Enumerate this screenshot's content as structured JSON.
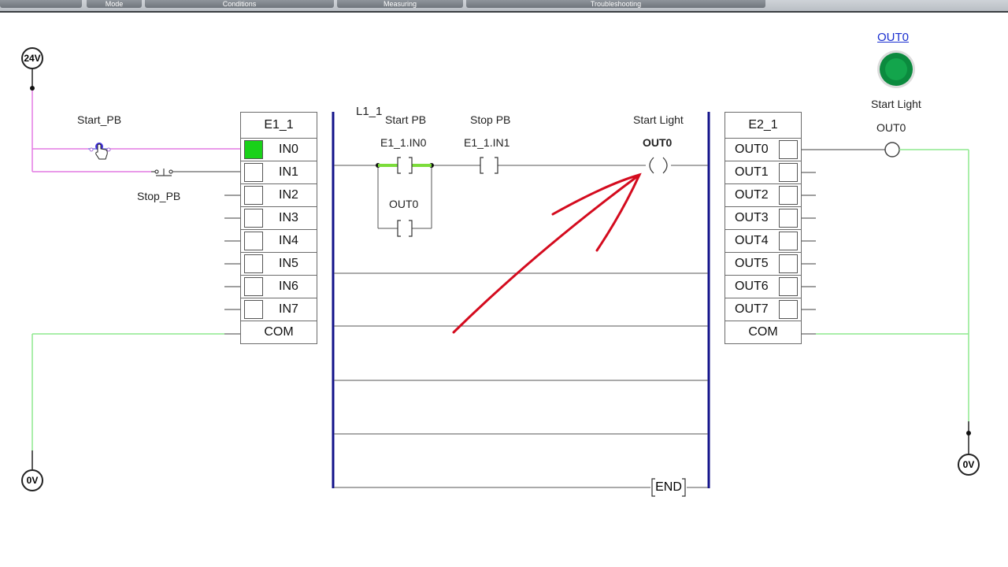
{
  "toolbar": {
    "tabs": [
      "",
      "Mode",
      "Conditions",
      "Measuring",
      "Troubleshooting"
    ]
  },
  "power": {
    "supply_24v": "24V",
    "ground_left": "0V",
    "ground_right": "0V"
  },
  "devices": {
    "start_pb": "Start_PB",
    "stop_pb": "Stop_PB"
  },
  "input_module": {
    "name": "E1_1",
    "channels": [
      {
        "label": "IN0",
        "on": true
      },
      {
        "label": "IN1",
        "on": false
      },
      {
        "label": "IN2",
        "on": false
      },
      {
        "label": "IN3",
        "on": false
      },
      {
        "label": "IN4",
        "on": false
      },
      {
        "label": "IN5",
        "on": false
      },
      {
        "label": "IN6",
        "on": false
      },
      {
        "label": "IN7",
        "on": false
      }
    ],
    "common": "COM"
  },
  "output_module": {
    "name": "E2_1",
    "channels": [
      {
        "label": "OUT0"
      },
      {
        "label": "OUT1"
      },
      {
        "label": "OUT2"
      },
      {
        "label": "OUT3"
      },
      {
        "label": "OUT4"
      },
      {
        "label": "OUT5"
      },
      {
        "label": "OUT6"
      },
      {
        "label": "OUT7"
      }
    ],
    "common": "COM"
  },
  "ladder": {
    "rung_label": "L1_1",
    "contact1_desc": "Start PB",
    "contact1_tag": "E1_1.IN0",
    "contact2_desc": "Stop PB",
    "contact2_tag": "E1_1.IN1",
    "seal_tag": "OUT0",
    "coil_desc": "Start Light",
    "coil_tag": "OUT0",
    "end_label": "END"
  },
  "indicator": {
    "link_label": "OUT0",
    "name": "Start Light",
    "terminal_label": "OUT0",
    "lamp_color": "#0b8a3e"
  },
  "colors": {
    "wire_pink": "#e27ae2",
    "wire_green": "#8ee88e",
    "rail_blue": "#12128a",
    "active_green": "#19d119",
    "annotation_red": "#d40b1e"
  }
}
